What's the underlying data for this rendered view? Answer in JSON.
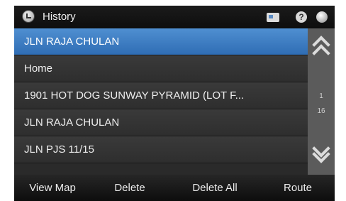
{
  "title": "History",
  "list": [
    "JLN RAJA CHULAN",
    "Home",
    "1901 HOT DOG SUNWAY PYRAMID (LOT F...",
    "JLN RAJA CHULAN",
    "JLN PJS 11/15"
  ],
  "selected_index": 0,
  "pagination": {
    "current": "1",
    "total": "16"
  },
  "buttons": {
    "view_map": "View Map",
    "delete": "Delete",
    "delete_all": "Delete All",
    "route": "Route"
  },
  "icons": {
    "title": "history-icon",
    "card": "card-icon",
    "help": "help-icon",
    "globe": "globe-icon"
  },
  "colors": {
    "selected_row": "#3e7ec4",
    "background": "#2a2a2a"
  }
}
